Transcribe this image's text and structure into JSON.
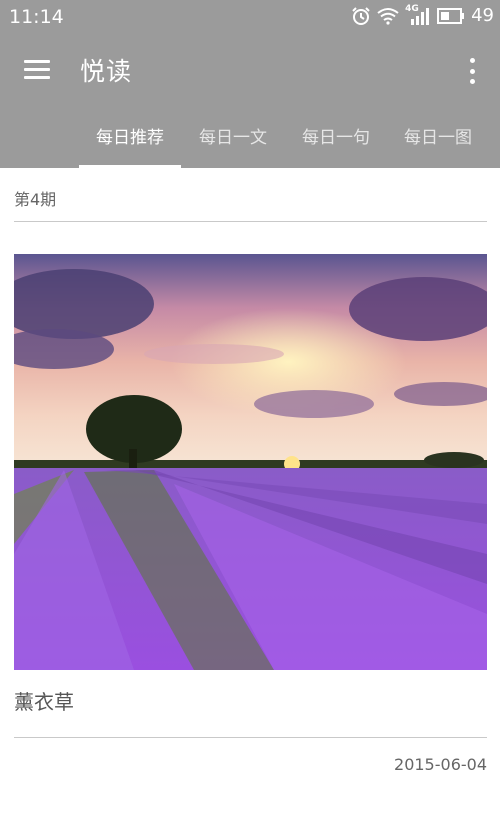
{
  "status_bar": {
    "time": "11:14",
    "network": "4G",
    "battery": "49",
    "icons": [
      "alarm-icon",
      "wifi-icon",
      "signal-icon",
      "battery-icon"
    ]
  },
  "app_bar": {
    "title": "悦读",
    "menu_icon": "hamburger-menu-icon",
    "more_icon": "overflow-menu-icon",
    "background": "#9b9b9b"
  },
  "tabs": [
    {
      "label": "每日推荐",
      "active": true
    },
    {
      "label": "每日一文",
      "active": false
    },
    {
      "label": "每日一句",
      "active": false
    },
    {
      "label": "每日一图",
      "active": false
    }
  ],
  "article": {
    "issue": "第4期",
    "caption": "薰衣草",
    "date": "2015-06-04",
    "image": "lavender-field-sunset"
  }
}
